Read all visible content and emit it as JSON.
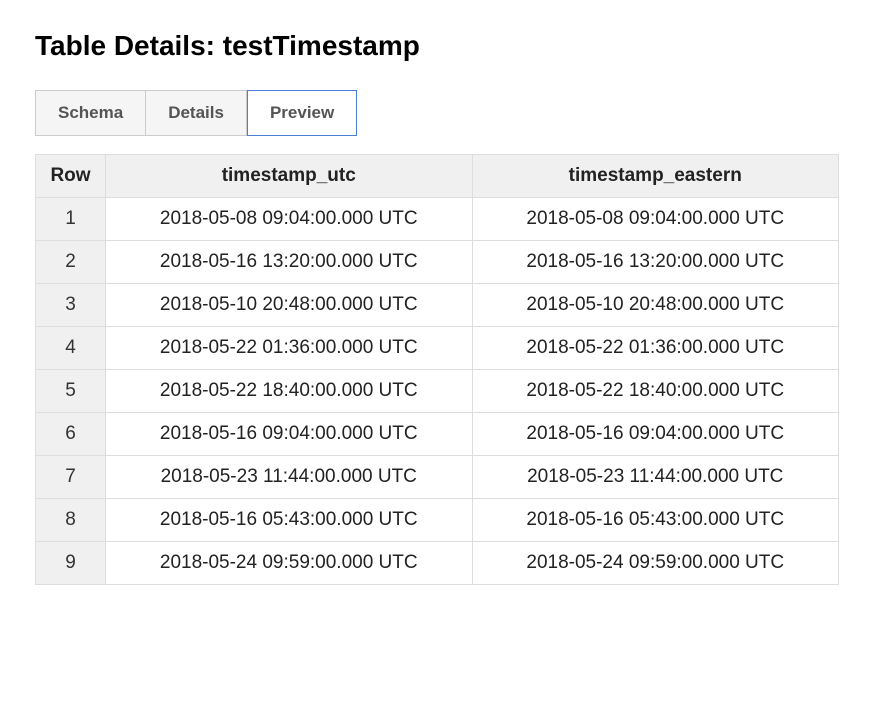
{
  "header": {
    "title": "Table Details: testTimestamp"
  },
  "tabs": [
    {
      "label": "Schema",
      "active": false
    },
    {
      "label": "Details",
      "active": false
    },
    {
      "label": "Preview",
      "active": true
    }
  ],
  "table": {
    "columns": [
      "Row",
      "timestamp_utc",
      "timestamp_eastern"
    ],
    "rows": [
      {
        "n": "1",
        "utc": "2018-05-08 09:04:00.000 UTC",
        "eastern": "2018-05-08 09:04:00.000 UTC"
      },
      {
        "n": "2",
        "utc": "2018-05-16 13:20:00.000 UTC",
        "eastern": "2018-05-16 13:20:00.000 UTC"
      },
      {
        "n": "3",
        "utc": "2018-05-10 20:48:00.000 UTC",
        "eastern": "2018-05-10 20:48:00.000 UTC"
      },
      {
        "n": "4",
        "utc": "2018-05-22 01:36:00.000 UTC",
        "eastern": "2018-05-22 01:36:00.000 UTC"
      },
      {
        "n": "5",
        "utc": "2018-05-22 18:40:00.000 UTC",
        "eastern": "2018-05-22 18:40:00.000 UTC"
      },
      {
        "n": "6",
        "utc": "2018-05-16 09:04:00.000 UTC",
        "eastern": "2018-05-16 09:04:00.000 UTC"
      },
      {
        "n": "7",
        "utc": "2018-05-23 11:44:00.000 UTC",
        "eastern": "2018-05-23 11:44:00.000 UTC"
      },
      {
        "n": "8",
        "utc": "2018-05-16 05:43:00.000 UTC",
        "eastern": "2018-05-16 05:43:00.000 UTC"
      },
      {
        "n": "9",
        "utc": "2018-05-24 09:59:00.000 UTC",
        "eastern": "2018-05-24 09:59:00.000 UTC"
      }
    ]
  }
}
